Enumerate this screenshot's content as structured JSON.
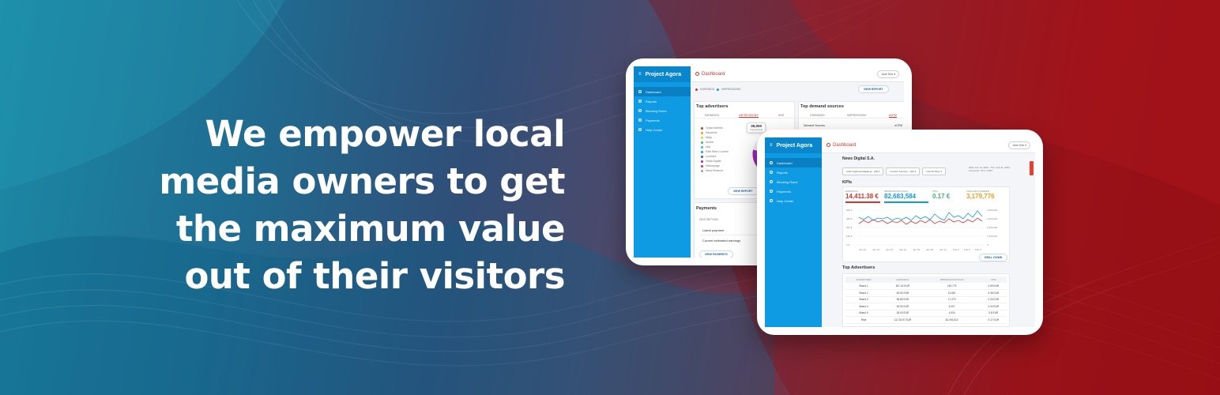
{
  "headline": {
    "lines": [
      "We empower local",
      "media owners to get",
      "the maximum value",
      "out of their visitors"
    ]
  },
  "colors": {
    "brand_blue": "#0f9be3",
    "accent_red": "#d9332a",
    "kpi_orange": "#f29b1a",
    "kpi_green": "#3cb371"
  },
  "back_tablet": {
    "logo": "Project Agora",
    "sidebar": [
      "Dashboard",
      "Reports",
      "Blocking Rules",
      "Payments",
      "Help Center"
    ],
    "breadcrumb": "Dashboard",
    "user_pill": "Jane Doe",
    "legend": [
      "EARNINGS",
      "IMPRESSIONS"
    ],
    "view_report": "VIEW REPORT",
    "top_advertisers": {
      "title": "Top advertisers",
      "tabs": [
        "EARNINGS",
        "IMPRESSIONS",
        "ADS"
      ],
      "items": [
        "Tyrian Airlines",
        "Harverda",
        "Maja",
        "Ambar",
        "Alfa",
        "Pale Retro Lucenn",
        "Leokhira",
        "Vitala Digital",
        "Hellonpage",
        "Nima Reserve"
      ],
      "tooltip_value": "35,000",
      "tooltip_label": "Impressions",
      "view_report": "VIEW REPORT"
    },
    "top_demand": {
      "title": "Top demand sources",
      "tabs": [
        "EARNINGS",
        "IMPRESSIONS",
        "eCPM"
      ],
      "col_left": "Demand Sources",
      "col_right": "eCPM"
    },
    "payments": {
      "title": "Payments",
      "header": "DESCRIPTION",
      "rows": [
        "Latest payment",
        "Current estimated earnings"
      ],
      "button": "VIEW PAYMENTS"
    }
  },
  "front_tablet": {
    "logo": "Project Agora",
    "sidebar": [
      "Dashboard",
      "Reports",
      "Blocking Rules",
      "Payments",
      "Help Center"
    ],
    "breadcrumb": "Dashboard",
    "user_pill": "Jane Doe",
    "publisher": "News Digital S.A.",
    "filters": [
      "Anthony@newsdigital.gr...(All)",
      "Content Sources - (All)",
      "Last 30 Days"
    ],
    "date_range": "Wed, Jan 13, 2021 - Thu, Feb 11, 2021",
    "timezone": "Timezone: UTC / GMT",
    "kpis_title": "KPIs",
    "kpis": [
      {
        "label": "EARNINGS",
        "value": "14,411.38 €"
      },
      {
        "label": "IMPRESSIONS SOLD",
        "value": "82,683,584"
      },
      {
        "label": "CPM",
        "value": "0.17 €"
      },
      {
        "label": "UNFILLED QUERIES",
        "value": "3,179,776"
      }
    ],
    "chart_x_labels": [
      "Jan 13",
      "Jan 16",
      "Jan 19",
      "Jan 22",
      "Jan 25",
      "Jan 28",
      "Jan 31",
      "Feb 3",
      "Feb 6",
      "Feb 9"
    ],
    "chart_y_left": [
      "600 €",
      "450 €",
      "300 €",
      "150 €",
      "0 €"
    ],
    "chart_y_right": [
      "4,000,000",
      "3,000,000",
      "2,000,000",
      "1,000,000",
      "0"
    ],
    "drill_down": "DRILL DOWN",
    "advertisers_title": "Top Advertisers",
    "table_headers": [
      "ADVERTISER",
      "EARNINGS",
      "IMPRESSIONS SOLD",
      "CPM"
    ],
    "table_rows": [
      [
        "Brand 1",
        "537.42 EUR",
        "149,779",
        "3.59 EUR"
      ],
      [
        "Brand 2",
        "45.92 EUR",
        "13,687",
        "3.36 EUR"
      ],
      [
        "Brand 3",
        "38.89 EUR",
        "17,279",
        "2.25 EUR"
      ],
      [
        "Brand 4",
        "26.93 EUR",
        "6,207",
        "4.34 EUR"
      ],
      [
        "Brand 5",
        "26.03 EUR",
        "4,534",
        "5.8 EUR"
      ],
      [
        "Rest",
        "13,734.97 EUR",
        "82,491,812",
        "0.17 EUR"
      ]
    ]
  }
}
